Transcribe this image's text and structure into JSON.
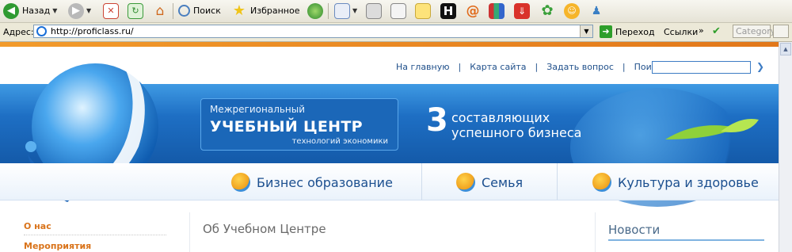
{
  "toolbar": {
    "back_label": "Назад",
    "search_label": "Поиск",
    "favorites_label": "Избранное"
  },
  "addressbar": {
    "label": "Адрес:",
    "url": "http://proficlass.ru/",
    "go_label": "Переход",
    "links_label": "Ссылки",
    "category_label": "Category"
  },
  "site": {
    "topnav": [
      "На главную",
      "Карта сайта",
      "Задать вопрос",
      "Поиск:"
    ],
    "banner": {
      "line1": "Межрегиональный",
      "line2": "УЧЕБНЫЙ ЦЕНТР",
      "line3": "технологий экономики",
      "number": "3",
      "slogan1": "составляющих",
      "slogan2": "успешного бизнеса"
    },
    "categories": [
      "Бизнес образование",
      "Семья",
      "Культура и здоровье"
    ],
    "sidebar": [
      "О нас",
      "Мероприятия"
    ],
    "main_title": "Об Учебном Центре",
    "news_title": "Новости"
  },
  "colors": {
    "accent_orange": "#e2771a",
    "brand_blue": "#1e6fc4",
    "link_blue": "#1f4f8a"
  }
}
